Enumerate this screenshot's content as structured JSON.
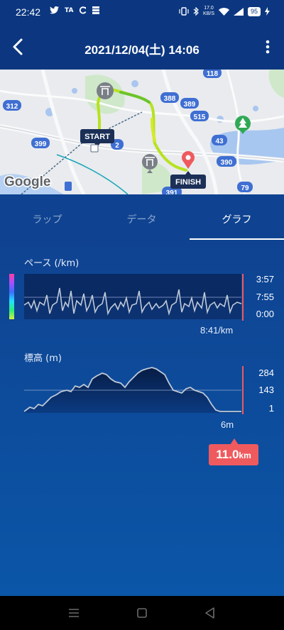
{
  "status": {
    "time": "22:42",
    "left_icons": [
      "twitter-icon",
      "ta-icon",
      "sync-icon",
      "layers-icon"
    ],
    "speed_value": "17.0",
    "speed_unit": "KB/S",
    "battery": "95"
  },
  "appbar": {
    "title": "2021/12/04(土) 14:06"
  },
  "map": {
    "labels": [
      "118",
      "312",
      "388",
      "389",
      "515",
      "399",
      "2",
      "43",
      "390",
      "79",
      "391"
    ],
    "start_label": "START",
    "finish_label": "FINISH",
    "brand": "Google"
  },
  "tabs": [
    {
      "label": "ラップ",
      "active": false
    },
    {
      "label": "データ",
      "active": false
    },
    {
      "label": "グラフ",
      "active": true
    }
  ],
  "pace_graph": {
    "title": "ペース (/km)",
    "axis_top": "3:57",
    "axis_mid": "7:55",
    "axis_bottom": "0:00",
    "current_value": "8:41/km"
  },
  "elevation_graph": {
    "title": "標高 (m)",
    "axis_top": "284",
    "axis_mid": "143",
    "axis_bottom": "1",
    "current_value": "6m"
  },
  "distance_badge": {
    "value": "11.0",
    "unit": "km"
  },
  "colors": {
    "header": "#0c3780",
    "accent": "#ef5a5e",
    "route": "#b7e21f"
  },
  "navbar": [
    "menu-icon",
    "home-icon",
    "back-triangle-icon"
  ]
}
